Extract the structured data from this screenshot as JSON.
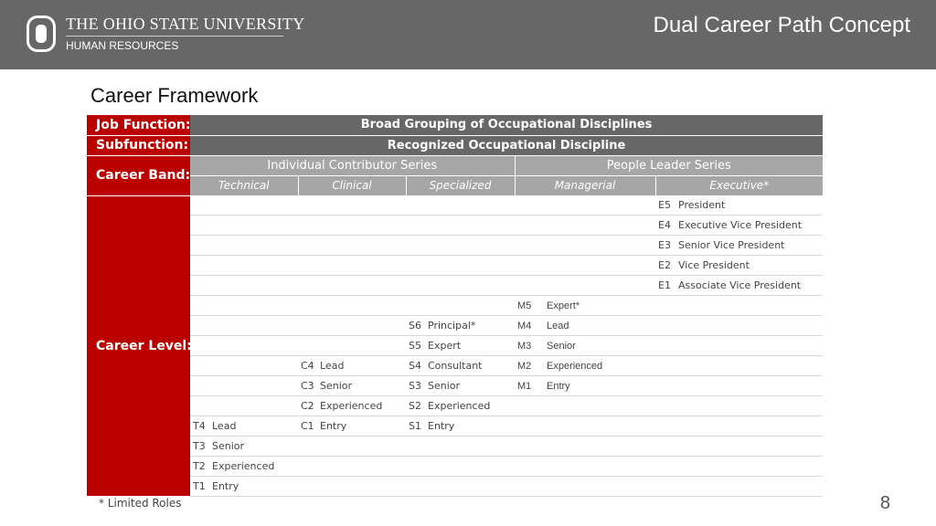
{
  "header": {
    "university": "THE OHIO STATE UNIVERSITY",
    "department": "HUMAN RESOURCES",
    "slide_title": "Dual Career Path Concept"
  },
  "framework": {
    "title": "Career Framework",
    "labels": {
      "job_function": "Job Function:",
      "subfunction": "Subfunction:",
      "career_band": "Career Band:",
      "career_level": "Career Level:"
    },
    "job_function_value": "Broad Grouping of Occupational Disciplines",
    "subfunction_value": "Recognized Occupational Discipline",
    "bands": {
      "individual": "Individual Contributor Series",
      "people": "People Leader Series"
    },
    "columns": [
      "Technical",
      "Clinical",
      "Specialized",
      "Managerial",
      "Executive*"
    ],
    "rows": [
      [
        "",
        "",
        "",
        "",
        "",
        "",
        "",
        "",
        "E5",
        "President"
      ],
      [
        "",
        "",
        "",
        "",
        "",
        "",
        "",
        "",
        "E4",
        "Executive Vice President"
      ],
      [
        "",
        "",
        "",
        "",
        "",
        "",
        "",
        "",
        "E3",
        "Senior Vice President"
      ],
      [
        "",
        "",
        "",
        "",
        "",
        "",
        "",
        "",
        "E2",
        "Vice President"
      ],
      [
        "",
        "",
        "",
        "",
        "",
        "",
        "",
        "",
        "E1",
        "Associate Vice President"
      ],
      [
        "",
        "",
        "",
        "",
        "",
        "",
        "M5",
        "Expert*",
        "",
        ""
      ],
      [
        "",
        "",
        "",
        "",
        "S6",
        "Principal*",
        "M4",
        "Lead",
        "",
        ""
      ],
      [
        "",
        "",
        "",
        "",
        "S5",
        "Expert",
        "M3",
        "Senior",
        "",
        ""
      ],
      [
        "",
        "",
        "C4",
        "Lead",
        "S4",
        "Consultant",
        "M2",
        "Experienced",
        "",
        ""
      ],
      [
        "",
        "",
        "C3",
        "Senior",
        "S3",
        "Senior",
        "M1",
        "Entry",
        "",
        ""
      ],
      [
        "",
        "",
        "C2",
        "Experienced",
        "S2",
        "Experienced",
        "",
        "",
        "",
        ""
      ],
      [
        "T4",
        "Lead",
        "C1",
        "Entry",
        "S1",
        "Entry",
        "",
        "",
        "",
        ""
      ],
      [
        "T3",
        "Senior",
        "",
        "",
        "",
        "",
        "",
        "",
        "",
        ""
      ],
      [
        "T2",
        "Experienced",
        "",
        "",
        "",
        "",
        "",
        "",
        "",
        ""
      ],
      [
        "T1",
        "Entry",
        "",
        "",
        "",
        "",
        "",
        "",
        "",
        ""
      ]
    ],
    "footnote": "* Limited Roles"
  },
  "page_number": "8",
  "colors": {
    "header": "#666766",
    "label_red": "#bb0000",
    "band_gray": "#a6a6a6"
  }
}
